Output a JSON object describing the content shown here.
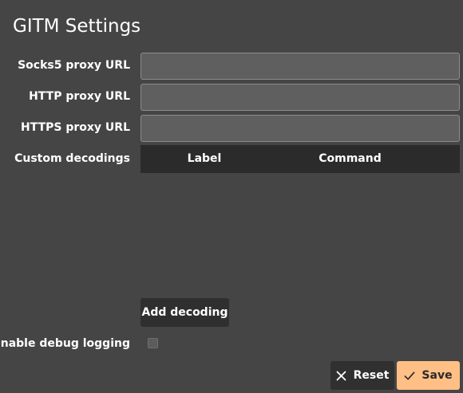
{
  "title": "GITM Settings",
  "fields": {
    "socks5": {
      "label": "Socks5 proxy URL",
      "value": "",
      "placeholder": ""
    },
    "http": {
      "label": "HTTP proxy URL",
      "value": "",
      "placeholder": ""
    },
    "https": {
      "label": "HTTPS proxy URL",
      "value": "",
      "placeholder": ""
    }
  },
  "custom_decodings": {
    "label": "Custom decodings",
    "columns": [
      "Label",
      "Command"
    ],
    "rows": [],
    "add_button": "Add decoding"
  },
  "debug_logging": {
    "label": "Enable debug logging",
    "checked": false
  },
  "actions": {
    "reset": {
      "label": "Reset",
      "icon": "close-icon"
    },
    "save": {
      "label": "Save",
      "icon": "checkmark-icon"
    }
  },
  "colors": {
    "background": "#454545",
    "input_bg": "#5f5f5f",
    "table_header_bg": "#2b2b2b",
    "button_bg": "#303030",
    "accent": "#ffbf85"
  }
}
